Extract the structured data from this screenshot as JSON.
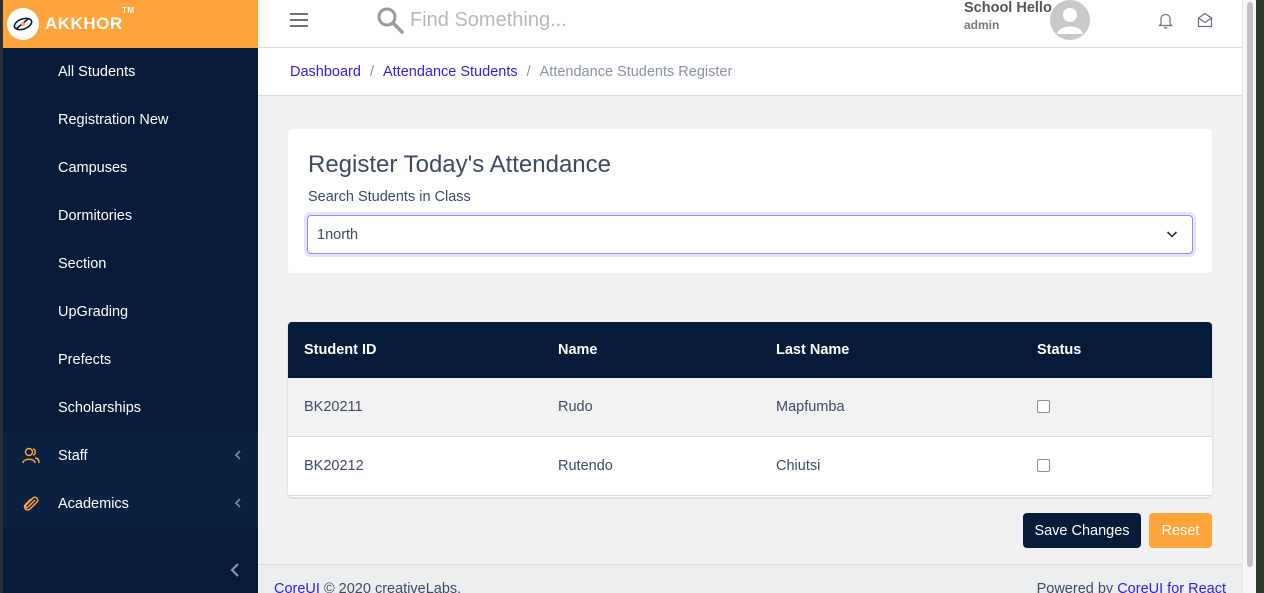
{
  "brand": {
    "name": "AKKHOR",
    "tm": "TM",
    "color": "#ffa43a"
  },
  "sidebar": {
    "items": [
      {
        "label": "All Students"
      },
      {
        "label": "Registration New"
      },
      {
        "label": "Campuses"
      },
      {
        "label": "Dormitories"
      },
      {
        "label": "Section"
      },
      {
        "label": "UpGrading"
      },
      {
        "label": "Prefects"
      },
      {
        "label": "Scholarships"
      }
    ],
    "groups": [
      {
        "label": "Staff",
        "icon": "users-icon"
      },
      {
        "label": "Academics",
        "icon": "paperclip-icon"
      }
    ]
  },
  "header": {
    "search_placeholder": "Find Something...",
    "user_name": "School Hello",
    "user_role": "admin"
  },
  "breadcrumb": {
    "items": [
      "Dashboard",
      "Attendance Students"
    ],
    "separator": "/",
    "active": "Attendance Students Register"
  },
  "form": {
    "title": "Register Today's Attendance",
    "label": "Search Students in Class",
    "selected_class": "1north"
  },
  "table": {
    "headers": [
      "Student ID",
      "Name",
      "Last Name",
      "Status"
    ],
    "rows": [
      {
        "id": "BK20211",
        "name": "Rudo",
        "last_name": "Mapfumba",
        "status": false
      },
      {
        "id": "BK20212",
        "name": "Rutendo",
        "last_name": "Chiutsi",
        "status": false
      }
    ]
  },
  "actions": {
    "save": "Save Changes",
    "reset": "Reset"
  },
  "footer": {
    "left_link": "CoreUI",
    "left_text": "© 2020 creativeLabs.",
    "right_text": "Powered by",
    "right_link": "CoreUI for React"
  },
  "colors": {
    "sidebar": "#061a3a",
    "accent": "#ffa43a",
    "link": "#321fdb"
  }
}
